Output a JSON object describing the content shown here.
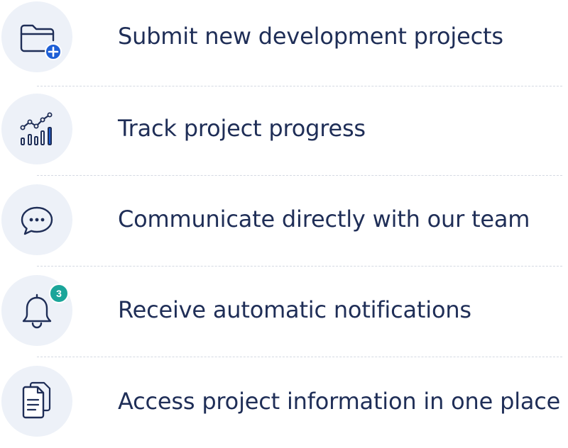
{
  "features": [
    {
      "label": "Submit new development projects",
      "icon": "folder-add-icon"
    },
    {
      "label": "Track project progress",
      "icon": "chart-progress-icon"
    },
    {
      "label": "Communicate directly with our team",
      "icon": "chat-bubble-icon"
    },
    {
      "label": "Receive automatic notifications",
      "icon": "bell-icon",
      "badge": "3"
    },
    {
      "label": "Access project information in one place",
      "icon": "documents-icon"
    }
  ],
  "colors": {
    "text": "#1f2e57",
    "icon_stroke": "#1f2e57",
    "circle_bg": "#edf1f8",
    "accent_blue": "#1e5fd6",
    "badge_teal": "#1aa59a",
    "divider": "#d4d9e2"
  }
}
